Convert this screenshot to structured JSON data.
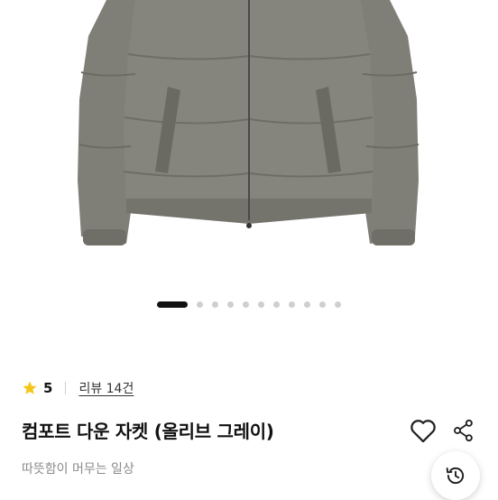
{
  "gallery": {
    "slide_count": 11,
    "active_index": 0
  },
  "rating": {
    "value": "5",
    "review_link": "리뷰 14건"
  },
  "product": {
    "title": "컴포트 다운 자켓 (올리브 그레이)",
    "brand_tagline": "따뜻함이 머무는 일상"
  },
  "colors": {
    "jacket": "#7e7e76",
    "star": "#f5c518",
    "dot_active": "#111111",
    "dot": "#cfcfcf"
  },
  "icons": [
    "heart-icon",
    "share-icon",
    "history-icon",
    "star-icon"
  ]
}
